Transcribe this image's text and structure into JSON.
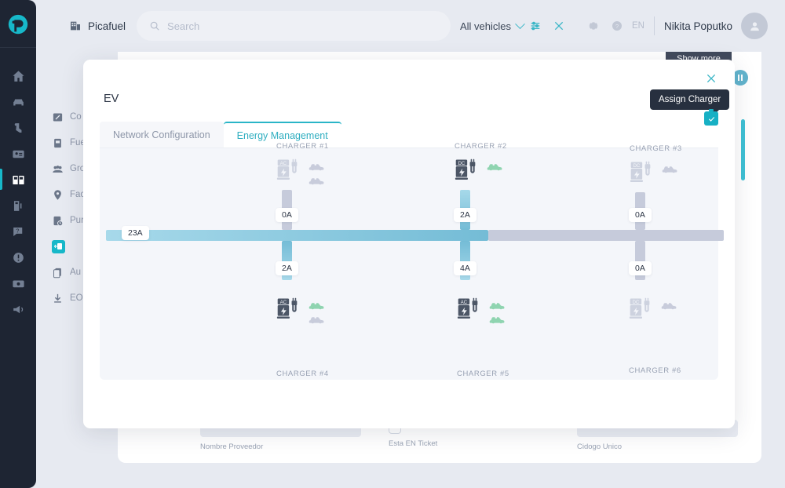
{
  "app": {
    "brand": "Picafuel",
    "search_placeholder": "Search",
    "vehicle_filter": "All vehicles",
    "language": "EN",
    "user_name": "Nikita Poputko",
    "show_more_label": "Show more"
  },
  "rail": {
    "items": [
      {
        "icon": "home-icon",
        "name": "home"
      },
      {
        "icon": "car-icon",
        "name": "vehicles"
      },
      {
        "icon": "driver-seat-icon",
        "name": "drivers"
      },
      {
        "icon": "id-card-icon",
        "name": "cards"
      },
      {
        "icon": "station-icon",
        "name": "stations",
        "active": true
      },
      {
        "icon": "fuel-pump-icon",
        "name": "fuel"
      },
      {
        "icon": "question-chat-icon",
        "name": "support"
      },
      {
        "icon": "alert-circle-icon",
        "name": "alerts"
      },
      {
        "icon": "payment-card-icon",
        "name": "payments"
      },
      {
        "icon": "megaphone-icon",
        "name": "announcements"
      }
    ]
  },
  "submenu": {
    "items": [
      {
        "label": "Co",
        "icon": "discount-icon"
      },
      {
        "label": "Fue",
        "icon": "fuel-doc-icon"
      },
      {
        "label": "Gro",
        "icon": "group-icon"
      },
      {
        "label": "Fac",
        "icon": "location-pin-icon"
      },
      {
        "label": "Pur",
        "icon": "purchase-clock-icon"
      },
      {
        "label": "",
        "icon": "energy-icon",
        "active": true
      },
      {
        "label": "Au",
        "icon": "document-copy-icon"
      },
      {
        "label": "EOI",
        "icon": "download-icon"
      }
    ]
  },
  "background_form": {
    "fields": [
      {
        "caption": "Nombre Proveedor",
        "type": "box"
      },
      {
        "caption": "Esta EN Ticket",
        "type": "checkbox"
      },
      {
        "caption": "Cidogo Unico",
        "type": "box"
      }
    ]
  },
  "modal": {
    "title": "EV",
    "close_icon": "close-icon",
    "tooltip": "Assign Charger",
    "tabs": [
      {
        "label": "Network Configuration",
        "active": false
      },
      {
        "label": "Energy Management",
        "active": true
      }
    ]
  },
  "chart_data": {
    "type": "diagram",
    "title": "Energy Management",
    "main_bus": {
      "label": "23A",
      "value": 23,
      "unit": "A",
      "active_color": "#9fd5e8",
      "inactive_color": "#c6cbdb"
    },
    "chargers": [
      {
        "id": "CHARGER #1",
        "row": "top",
        "type": "AC",
        "active": false,
        "amps": "0A",
        "value": 0,
        "cars": [
          {
            "state": "idle"
          },
          {
            "state": "idle"
          }
        ]
      },
      {
        "id": "CHARGER #2",
        "row": "top",
        "type": "DC",
        "active": true,
        "amps": "2A",
        "value": 2,
        "cars": [
          {
            "state": "charging"
          }
        ]
      },
      {
        "id": "CHARGER #3",
        "row": "top",
        "type": "DC",
        "active": false,
        "amps": "0A",
        "value": 0,
        "cars": [
          {
            "state": "idle"
          }
        ]
      },
      {
        "id": "CHARGER #4",
        "row": "bottom",
        "type": "AC",
        "active": true,
        "amps": "2A",
        "value": 2,
        "cars": [
          {
            "state": "charging"
          },
          {
            "state": "idle"
          }
        ]
      },
      {
        "id": "CHARGER #5",
        "row": "bottom",
        "type": "AC",
        "active": true,
        "amps": "4A",
        "value": 4,
        "cars": [
          {
            "state": "charging"
          },
          {
            "state": "charging"
          }
        ]
      },
      {
        "id": "CHARGER #6",
        "row": "bottom",
        "type": "DC",
        "active": false,
        "amps": "0A",
        "value": 0,
        "cars": [
          {
            "state": "idle"
          }
        ]
      }
    ],
    "colors": {
      "accent": "#17b8c9",
      "active_branch": "#8ccfe4",
      "inactive_branch": "#c6cbdb",
      "car_charging": "#8fd4b0",
      "car_idle": "#c8ccdb",
      "station_active": "#4c5666",
      "station_inactive": "#cdd2df"
    }
  }
}
